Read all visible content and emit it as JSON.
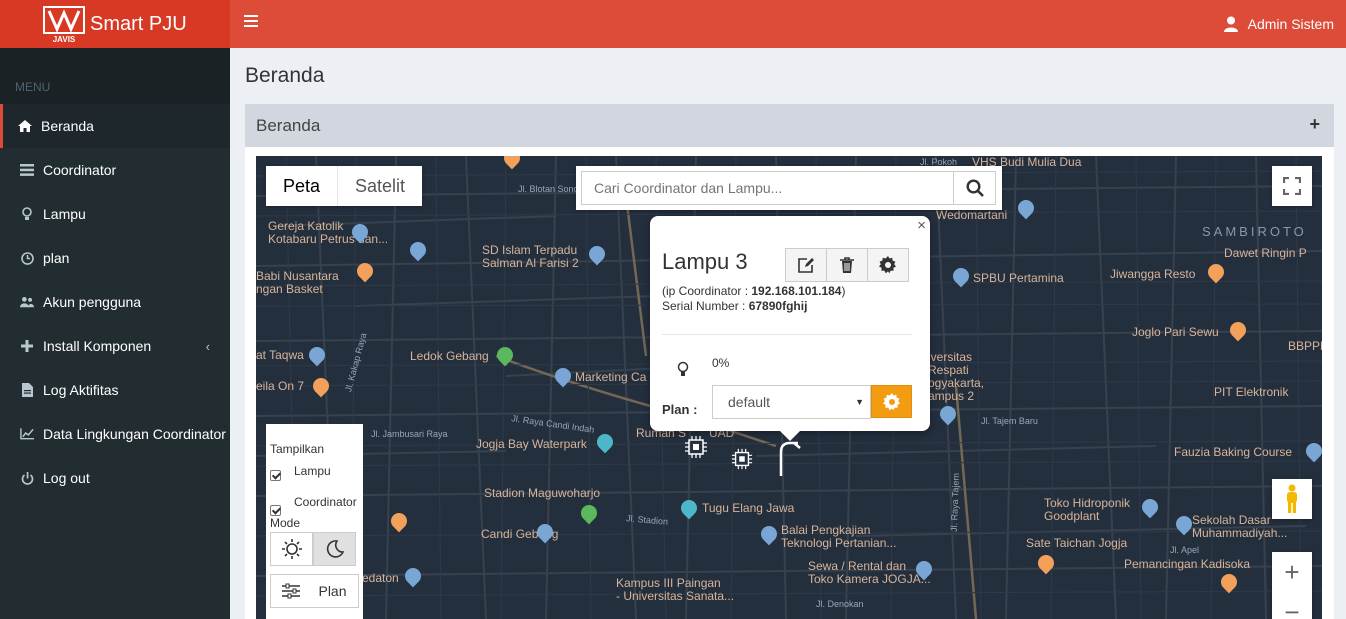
{
  "app": {
    "brand": "Smart PJU",
    "logo_text": "JAVIS",
    "user_name": "Admin Sistem"
  },
  "sidebar": {
    "header": "MENU",
    "items": [
      {
        "label": "Beranda",
        "icon": "home-icon",
        "active": true
      },
      {
        "label": "Coordinator",
        "icon": "list-icon"
      },
      {
        "label": "Lampu",
        "icon": "lightbulb-icon"
      },
      {
        "label": "plan",
        "icon": "clock-icon"
      },
      {
        "label": "Akun pengguna",
        "icon": "users-icon"
      },
      {
        "label": "Install Komponen",
        "icon": "plus-icon",
        "chevron": "‹"
      },
      {
        "label": "Log Aktifitas",
        "icon": "file-icon"
      },
      {
        "label": "Data Lingkungan Coordinator",
        "icon": "line-chart-icon"
      },
      {
        "label": "Log out",
        "icon": "power-icon"
      }
    ]
  },
  "page": {
    "title": "Beranda",
    "box_title": "Beranda",
    "box_tool": "+"
  },
  "map": {
    "tabs": [
      "Peta",
      "Satelit"
    ],
    "search_placeholder": "Cari Coordinator dan Lampu...",
    "controls": {
      "zoom_in": "+",
      "zoom_out": "−"
    },
    "panel": {
      "title": "Tampilkan",
      "checkbox_lampu": "Lampu",
      "checkbox_coordinator": "Coordinator",
      "mode_label": "Mode",
      "plan_button": "Plan"
    },
    "labels": {
      "gereja": "Gereja Katolik\nKotabaru Petrus dan...",
      "sd": "SD Islam Terpadu\nSalman Al Farisi 2",
      "babi": "Babi Nusantara\nngan Basket",
      "taqwa": "at Taqwa",
      "ledok": "Ledok Gebang",
      "marketing": "Marketing Ca",
      "leila": "eila On 7",
      "jogja_bay": "Jogja Bay Waterpark",
      "rumah": "Rumah S",
      "uad": "UAD",
      "stadion": "Stadion Maguwoharjo",
      "tugu": "Tugu Elang Jawa",
      "candi": "Candi Gebang",
      "balai": "Balai Pengkajian\nTeknologi Pertanian...",
      "kampus": "Kampus III Paingan\n- Universitas Sanata...",
      "sewa": "Sewa / Rental dan\nToko Kamera JOGJA...",
      "vhs": "VHS Budi Mulia Dua",
      "wedomartani": "Wedomartani",
      "sambiroto": "SAMBIROTO",
      "dawet": "Dawet Ringin P",
      "spbu": "SPBU Pertamina",
      "jiwangga": "Jiwangga Resto",
      "joglo": "Joglo Pari Sewu",
      "bbppk": "BBPPK",
      "universitas": "iversitas\nRespati\nogyakarta,\nampus 2",
      "pit": "PIT Elektronik",
      "fauzia": "Fauzia Baking Course",
      "toko": "Toko Hidroponik\nGoodplant",
      "sekolah": "Sekolah Dasar\nMuhammadiyah...",
      "sate": "Sate Taichan Jogja",
      "pemancingan": "Pemancingan Kadisoka",
      "edaton": "edaton",
      "jl_blotan": "Jl. Blotan Sono",
      "jl_pokoh": "Jl. Pokoh",
      "jl_kakap": "Jl. Kakap Raya",
      "jl_raya_candi": "Jl. Raya Candi Indah",
      "jl_jambusari": "Jl. Jambusari Raya",
      "jl_stadion": "Jl. Stadion",
      "jl_tajem": "Jl. Raya Tajem",
      "jl_tajem_baru": "Jl. Tajem Baru",
      "jl_apel": "Jl. Apel",
      "jl_denokan": "Jl. Denokan"
    }
  },
  "infowindow": {
    "title": "Lampu 3",
    "close": "×",
    "ip_prefix": "(ip Coordinator : ",
    "ip": "192.168.101.184",
    "ip_suffix": ")",
    "serial_prefix": "Serial Number : ",
    "serial": "67890fghij",
    "brightness": "0%",
    "brightness_fraction": 0,
    "plan_label": "Plan :",
    "plan_value": "default",
    "select_caret": "▼"
  },
  "colors": {
    "header": "#dd4b39",
    "logo_bg": "#d73925",
    "sidebar": "#222d32",
    "map_bg": "#242f3e",
    "gear_button": "#f39c12"
  }
}
